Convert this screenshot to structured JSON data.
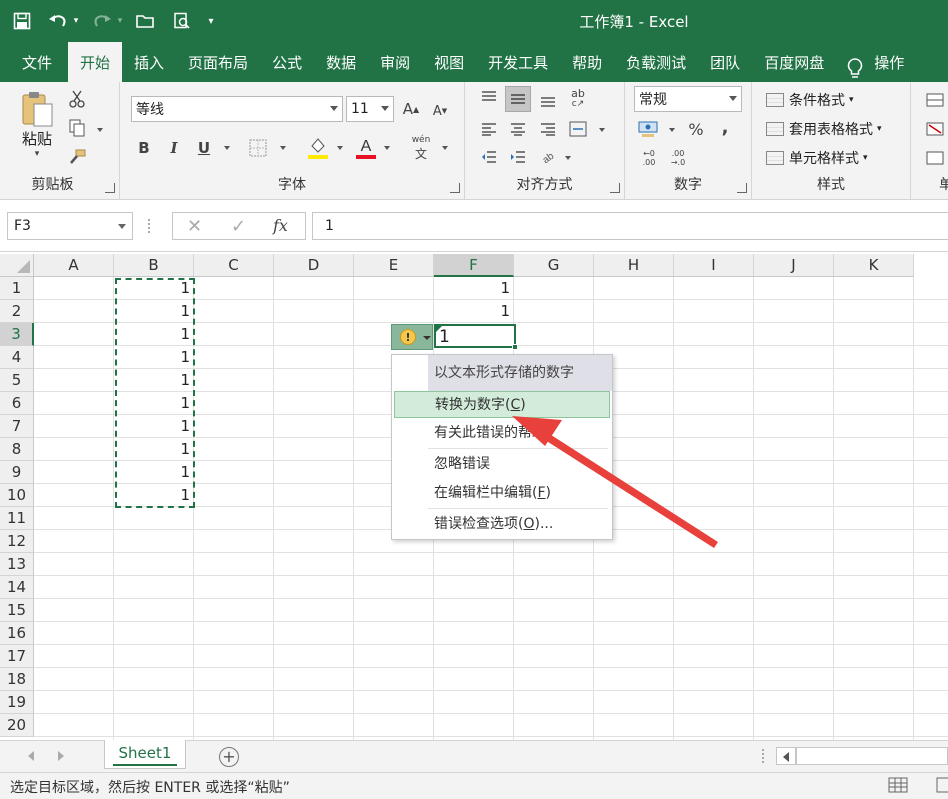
{
  "title": "工作簿1  -  Excel",
  "tabs": [
    {
      "label": "文件"
    },
    {
      "label": "开始"
    },
    {
      "label": "插入"
    },
    {
      "label": "页面布局"
    },
    {
      "label": "公式"
    },
    {
      "label": "数据"
    },
    {
      "label": "审阅"
    },
    {
      "label": "视图"
    },
    {
      "label": "开发工具"
    },
    {
      "label": "帮助"
    },
    {
      "label": "负载测试"
    },
    {
      "label": "团队"
    },
    {
      "label": "百度网盘"
    }
  ],
  "tell_me": "操作",
  "ribbon": {
    "clipboard": {
      "label": "剪贴板",
      "paste": "粘贴"
    },
    "font": {
      "label": "字体",
      "name": "等线",
      "size": "11",
      "bold": "B",
      "italic": "I",
      "underline": "U",
      "wen": "wén"
    },
    "alignment": {
      "label": "对齐方式"
    },
    "number": {
      "label": "数字",
      "format": "常规",
      "percent": "%",
      "comma": ","
    },
    "styles": {
      "label": "样式",
      "conditional": "条件格式",
      "table": "套用表格格式",
      "cell": "单元格样式"
    },
    "cells_partial": "单"
  },
  "formula_bar": {
    "name_box": "F3",
    "value": "1",
    "fx": "fx"
  },
  "columns": [
    "A",
    "B",
    "C",
    "D",
    "E",
    "F",
    "G",
    "H",
    "I",
    "J",
    "K"
  ],
  "rows": [
    "1",
    "2",
    "3",
    "4",
    "5",
    "6",
    "7",
    "8",
    "9",
    "10",
    "11",
    "12",
    "13",
    "14",
    "15",
    "16",
    "17",
    "18",
    "19",
    "20"
  ],
  "cells": {
    "B": [
      "1",
      "1",
      "1",
      "1",
      "1",
      "1",
      "1",
      "1",
      "1",
      "1"
    ],
    "F1": "1",
    "F2": "1",
    "F3": "1"
  },
  "error_menu": {
    "header": "以文本形式存储的数字",
    "items": [
      {
        "label": "转换为数字(C)",
        "text": "转换为数字(",
        "key": "C",
        "close": ")"
      },
      {
        "label": "有关此错误的帮助",
        "text": "有关此错误的帮助"
      },
      {
        "label": "忽略错误",
        "text": "忽略错误"
      },
      {
        "label": "在编辑栏中编辑(F)",
        "text": "在编辑栏中编辑(",
        "key": "F",
        "close": ")"
      },
      {
        "label": "错误检查选项(O)...",
        "text": "错误检查选项(",
        "key": "O",
        "close": ")..."
      }
    ]
  },
  "sheet_tab": "Sheet1",
  "status_text": "选定目标区域，然后按 ENTER 或选择“粘贴”",
  "colors": {
    "accent": "#217346",
    "highlight": "#d3ecd9",
    "arrow": "#e8403a"
  }
}
